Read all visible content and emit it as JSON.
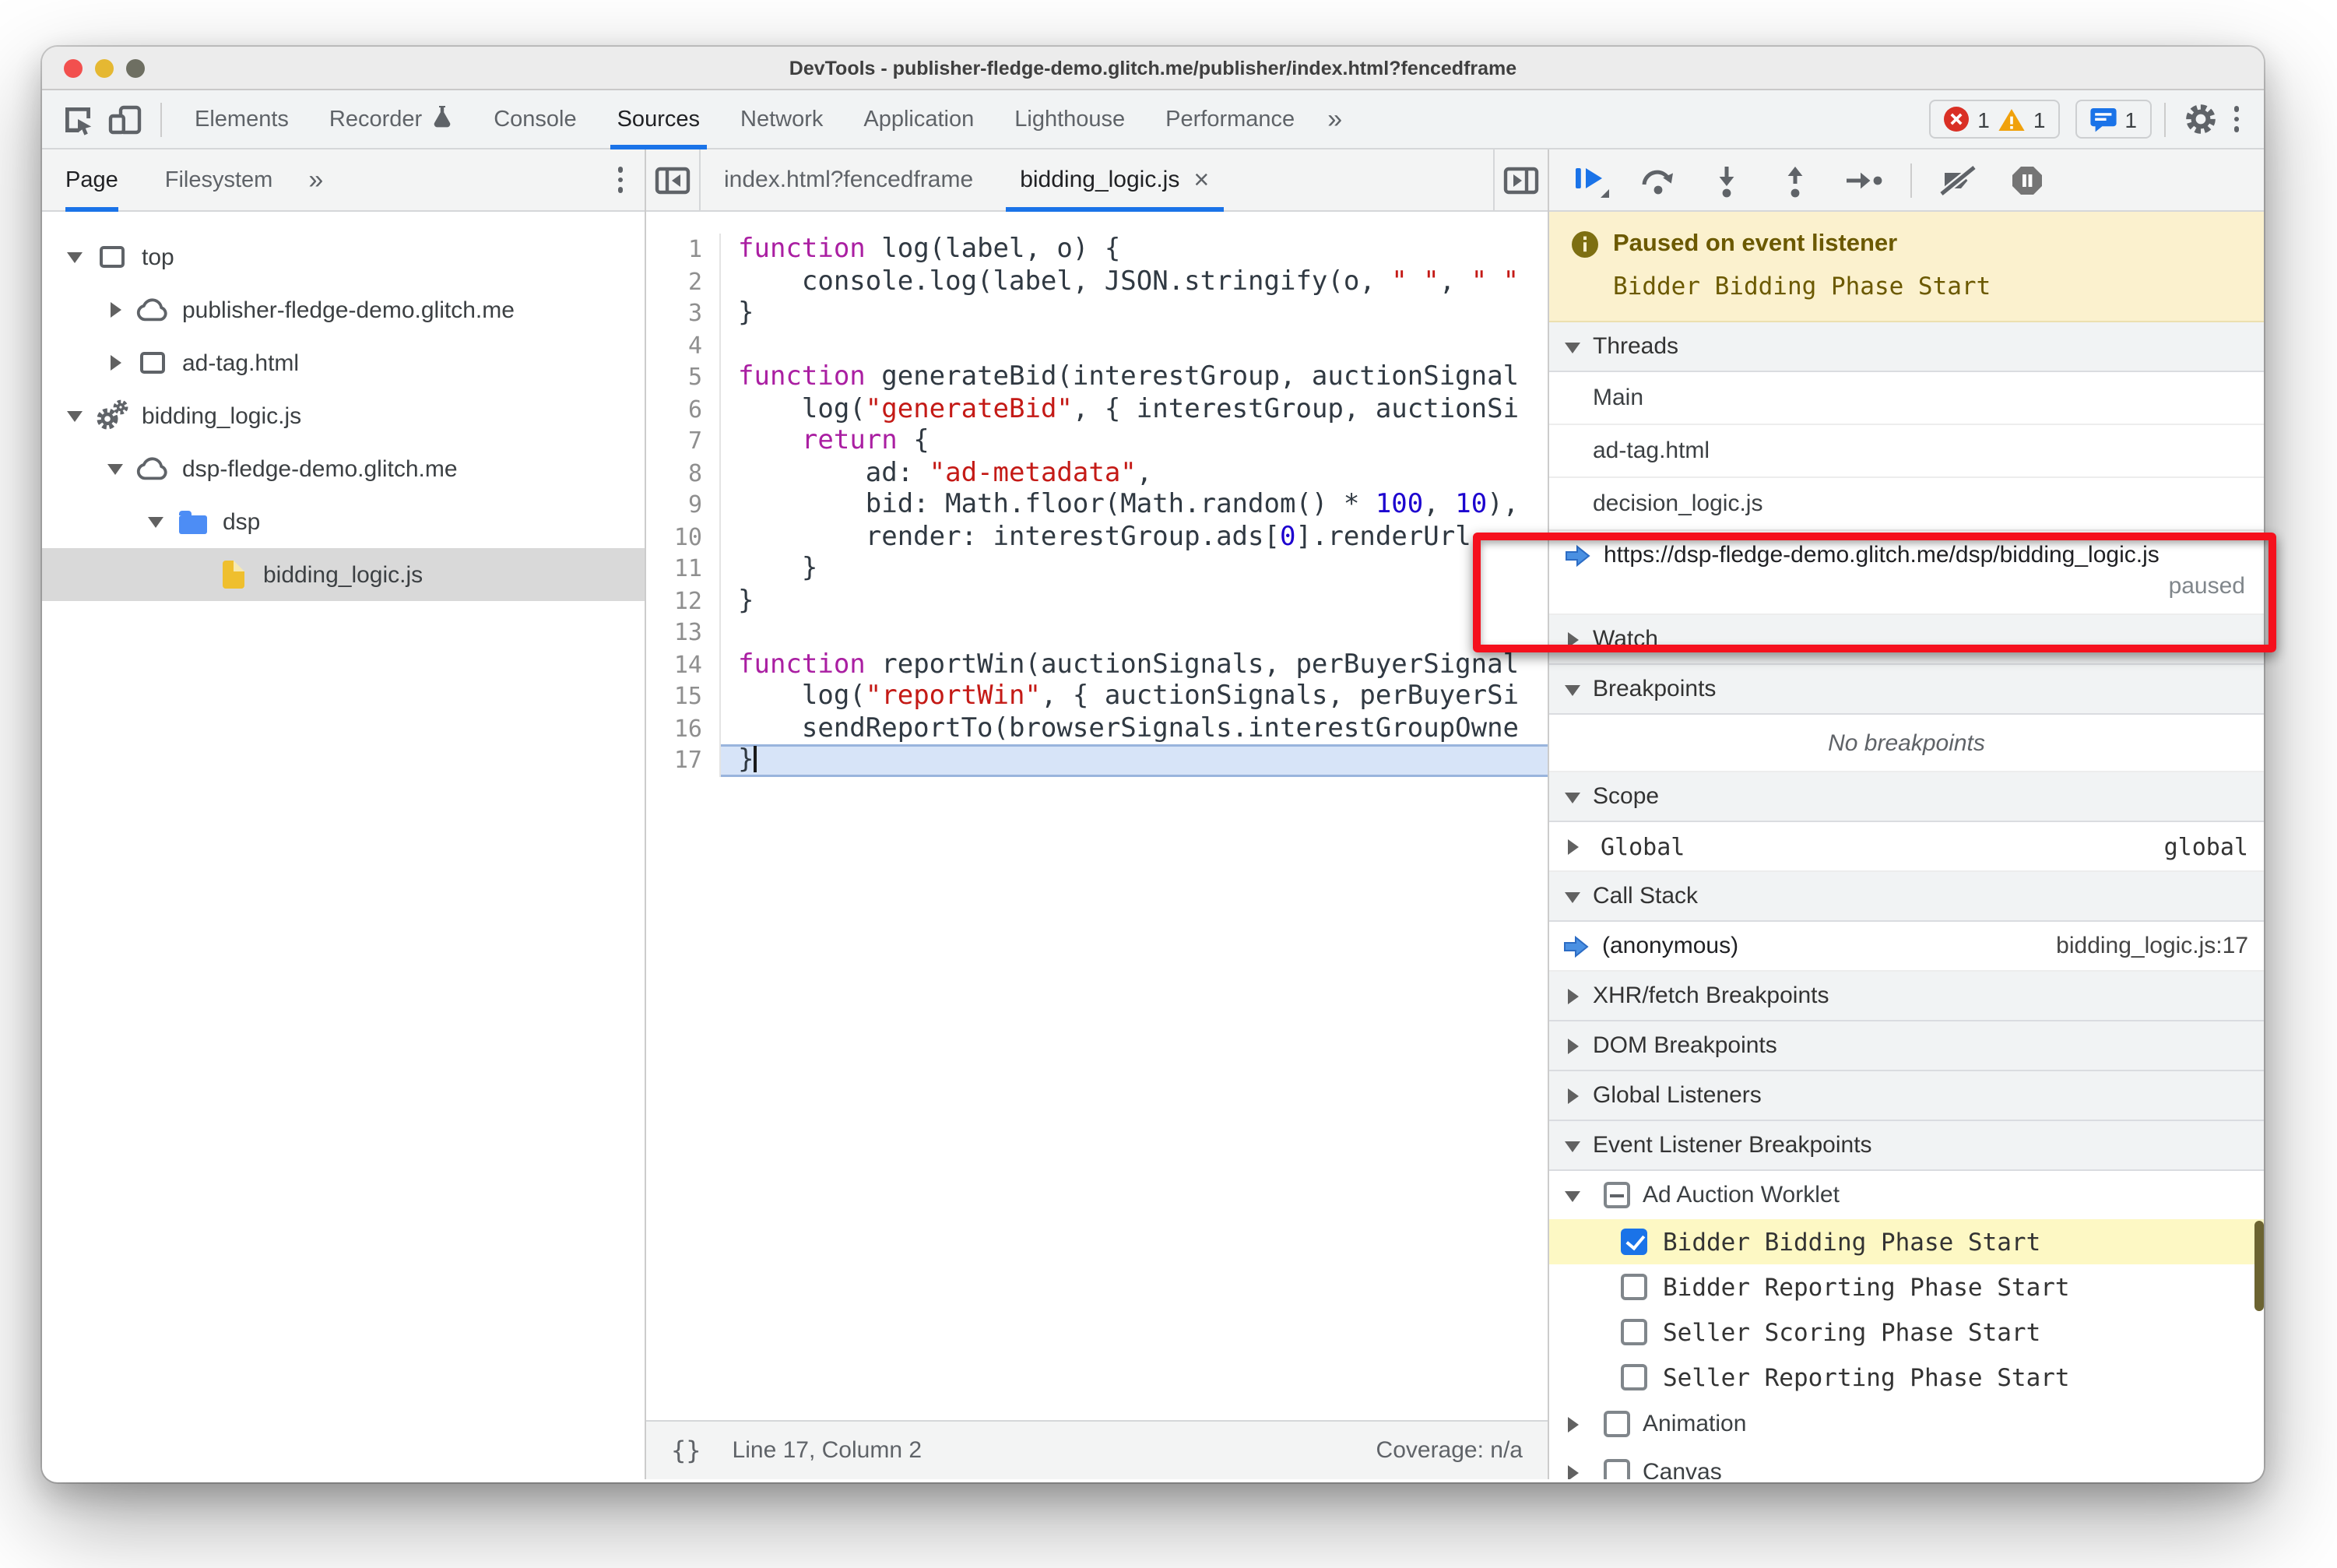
{
  "window": {
    "title": "DevTools - publisher-fledge-demo.glitch.me/publisher/index.html?fencedframe"
  },
  "toolbar": {
    "tabs": [
      {
        "label": "Elements"
      },
      {
        "label": "Recorder",
        "flask": true
      },
      {
        "label": "Console"
      },
      {
        "label": "Sources",
        "active": true
      },
      {
        "label": "Network"
      },
      {
        "label": "Application"
      },
      {
        "label": "Lighthouse"
      },
      {
        "label": "Performance"
      }
    ],
    "more_label": "»",
    "badges": {
      "errors": "1",
      "warnings": "1",
      "issues": "1"
    }
  },
  "sidebar": {
    "tabs": [
      {
        "label": "Page",
        "active": true
      },
      {
        "label": "Filesystem"
      }
    ],
    "more_label": "»",
    "tree": [
      {
        "indent": 0,
        "arrow": "down",
        "icon": "frame",
        "label": "top"
      },
      {
        "indent": 1,
        "arrow": "right",
        "icon": "cloud",
        "label": "publisher-fledge-demo.glitch.me"
      },
      {
        "indent": 1,
        "arrow": "right",
        "icon": "frame",
        "label": "ad-tag.html"
      },
      {
        "indent": 0,
        "arrow": "down",
        "icon": "gears",
        "label": "bidding_logic.js"
      },
      {
        "indent": 1,
        "arrow": "down",
        "icon": "cloud",
        "label": "dsp-fledge-demo.glitch.me"
      },
      {
        "indent": 2,
        "arrow": "down",
        "icon": "folder",
        "label": "dsp"
      },
      {
        "indent": 3,
        "arrow": "none",
        "icon": "file",
        "label": "bidding_logic.js",
        "selected": true
      }
    ]
  },
  "editor": {
    "tabs": [
      {
        "label": "index.html?fencedframe"
      },
      {
        "label": "bidding_logic.js",
        "active": true,
        "close": "×"
      }
    ],
    "lines": [
      {
        "n": "1",
        "t": [
          [
            "function",
            "k"
          ],
          [
            " log(label, o) {",
            "p"
          ]
        ]
      },
      {
        "n": "2",
        "t": [
          [
            "    console.log(label, JSON.stringify(o, ",
            "p"
          ],
          [
            "\" \"",
            "s"
          ],
          [
            ", ",
            "p"
          ],
          [
            "\" \"",
            "s"
          ]
        ]
      },
      {
        "n": "3",
        "t": [
          [
            "}",
            "p"
          ]
        ]
      },
      {
        "n": "4",
        "t": []
      },
      {
        "n": "5",
        "t": [
          [
            "function",
            "k"
          ],
          [
            " generateBid(interestGroup, auctionSignal",
            "p"
          ]
        ]
      },
      {
        "n": "6",
        "t": [
          [
            "    log(",
            "p"
          ],
          [
            "\"generateBid\"",
            "s"
          ],
          [
            ", { interestGroup, auctionSi",
            "p"
          ]
        ]
      },
      {
        "n": "7",
        "t": [
          [
            "    ",
            "p"
          ],
          [
            "return",
            "k"
          ],
          [
            " {",
            "p"
          ]
        ]
      },
      {
        "n": "8",
        "t": [
          [
            "        ad: ",
            "p"
          ],
          [
            "\"ad-metadata\"",
            "s"
          ],
          [
            ",",
            "p"
          ]
        ]
      },
      {
        "n": "9",
        "t": [
          [
            "        bid: Math.floor(Math.random() * ",
            "p"
          ],
          [
            "100",
            "n"
          ],
          [
            ", ",
            "p"
          ],
          [
            "10",
            "n"
          ],
          [
            "),",
            "p"
          ]
        ]
      },
      {
        "n": "10",
        "t": [
          [
            "        render: interestGroup.ads[",
            "p"
          ],
          [
            "0",
            "n"
          ],
          [
            "].renderUrl",
            "p"
          ]
        ]
      },
      {
        "n": "11",
        "t": [
          [
            "    }",
            "p"
          ]
        ]
      },
      {
        "n": "12",
        "t": [
          [
            "}",
            "p"
          ]
        ]
      },
      {
        "n": "13",
        "t": []
      },
      {
        "n": "14",
        "t": [
          [
            "function",
            "k"
          ],
          [
            " reportWin(auctionSignals, perBuyerSignal",
            "p"
          ]
        ]
      },
      {
        "n": "15",
        "t": [
          [
            "    log(",
            "p"
          ],
          [
            "\"reportWin\"",
            "s"
          ],
          [
            ", { auctionSignals, perBuyerSi",
            "p"
          ]
        ]
      },
      {
        "n": "16",
        "t": [
          [
            "    sendReportTo(browserSignals.interestGroupOwne",
            "p"
          ]
        ]
      },
      {
        "n": "17",
        "t": [
          [
            "}",
            "p"
          ]
        ],
        "hl": true,
        "cursor": true
      }
    ],
    "status": {
      "brackets": "{}",
      "position": "Line 17, Column 2",
      "coverage": "Coverage: n/a"
    }
  },
  "debugger": {
    "toolbar_buttons": [
      "resume",
      "step-over",
      "step-into",
      "step-out",
      "step",
      "deactivate-breakpoints",
      "pause-on-exceptions"
    ],
    "paused_banner": {
      "title": "Paused on event listener",
      "subtitle": "Bidder Bidding Phase Start"
    },
    "threads": {
      "label": "Threads",
      "items": [
        {
          "label": "Main"
        },
        {
          "label": "ad-tag.html"
        },
        {
          "label": "decision_logic.js"
        }
      ],
      "paused_thread": {
        "url": "https://dsp-fledge-demo.glitch.me/dsp/bidding_logic.js",
        "status": "paused"
      }
    },
    "watch_label": "Watch",
    "breakpoints": {
      "label": "Breakpoints",
      "empty": "No breakpoints"
    },
    "scope": {
      "label": "Scope",
      "rows": [
        {
          "name": "Global",
          "value": "global"
        }
      ]
    },
    "call_stack": {
      "label": "Call Stack",
      "frames": [
        {
          "name": "(anonymous)",
          "location": "bidding_logic.js:17"
        }
      ]
    },
    "xhr_label": "XHR/fetch Breakpoints",
    "dom_label": "DOM Breakpoints",
    "global_listeners_label": "Global Listeners",
    "event_listener_breakpoints": {
      "label": "Event Listener Breakpoints",
      "groups": [
        {
          "label": "Ad Auction Worklet",
          "state": "indeterminate",
          "expanded": true,
          "children": [
            {
              "label": "Bidder Bidding Phase Start",
              "checked": true,
              "highlighted": true
            },
            {
              "label": "Bidder Reporting Phase Start",
              "checked": false
            },
            {
              "label": "Seller Scoring Phase Start",
              "checked": false
            },
            {
              "label": "Seller Reporting Phase Start",
              "checked": false
            }
          ]
        },
        {
          "label": "Animation",
          "state": "unchecked",
          "expanded": false,
          "children": []
        },
        {
          "label": "Canvas",
          "state": "unchecked",
          "expanded": false,
          "children": []
        }
      ]
    }
  },
  "colors": {
    "accent_blue": "#1a73e8",
    "annotation_red": "#f5101d",
    "banner_bg": "#fbf1ce",
    "banner_text": "#6b5900",
    "selected_row_gray": "#d9d9d9",
    "highlight_yellow": "#fdf8c4",
    "exec_line_blue": "#d7e4f8",
    "keyword": "#aa1fa2",
    "string": "#c41a16",
    "number": "#1c00cf",
    "error_red": "#d93025",
    "warning_yellow": "#f0a10c"
  }
}
